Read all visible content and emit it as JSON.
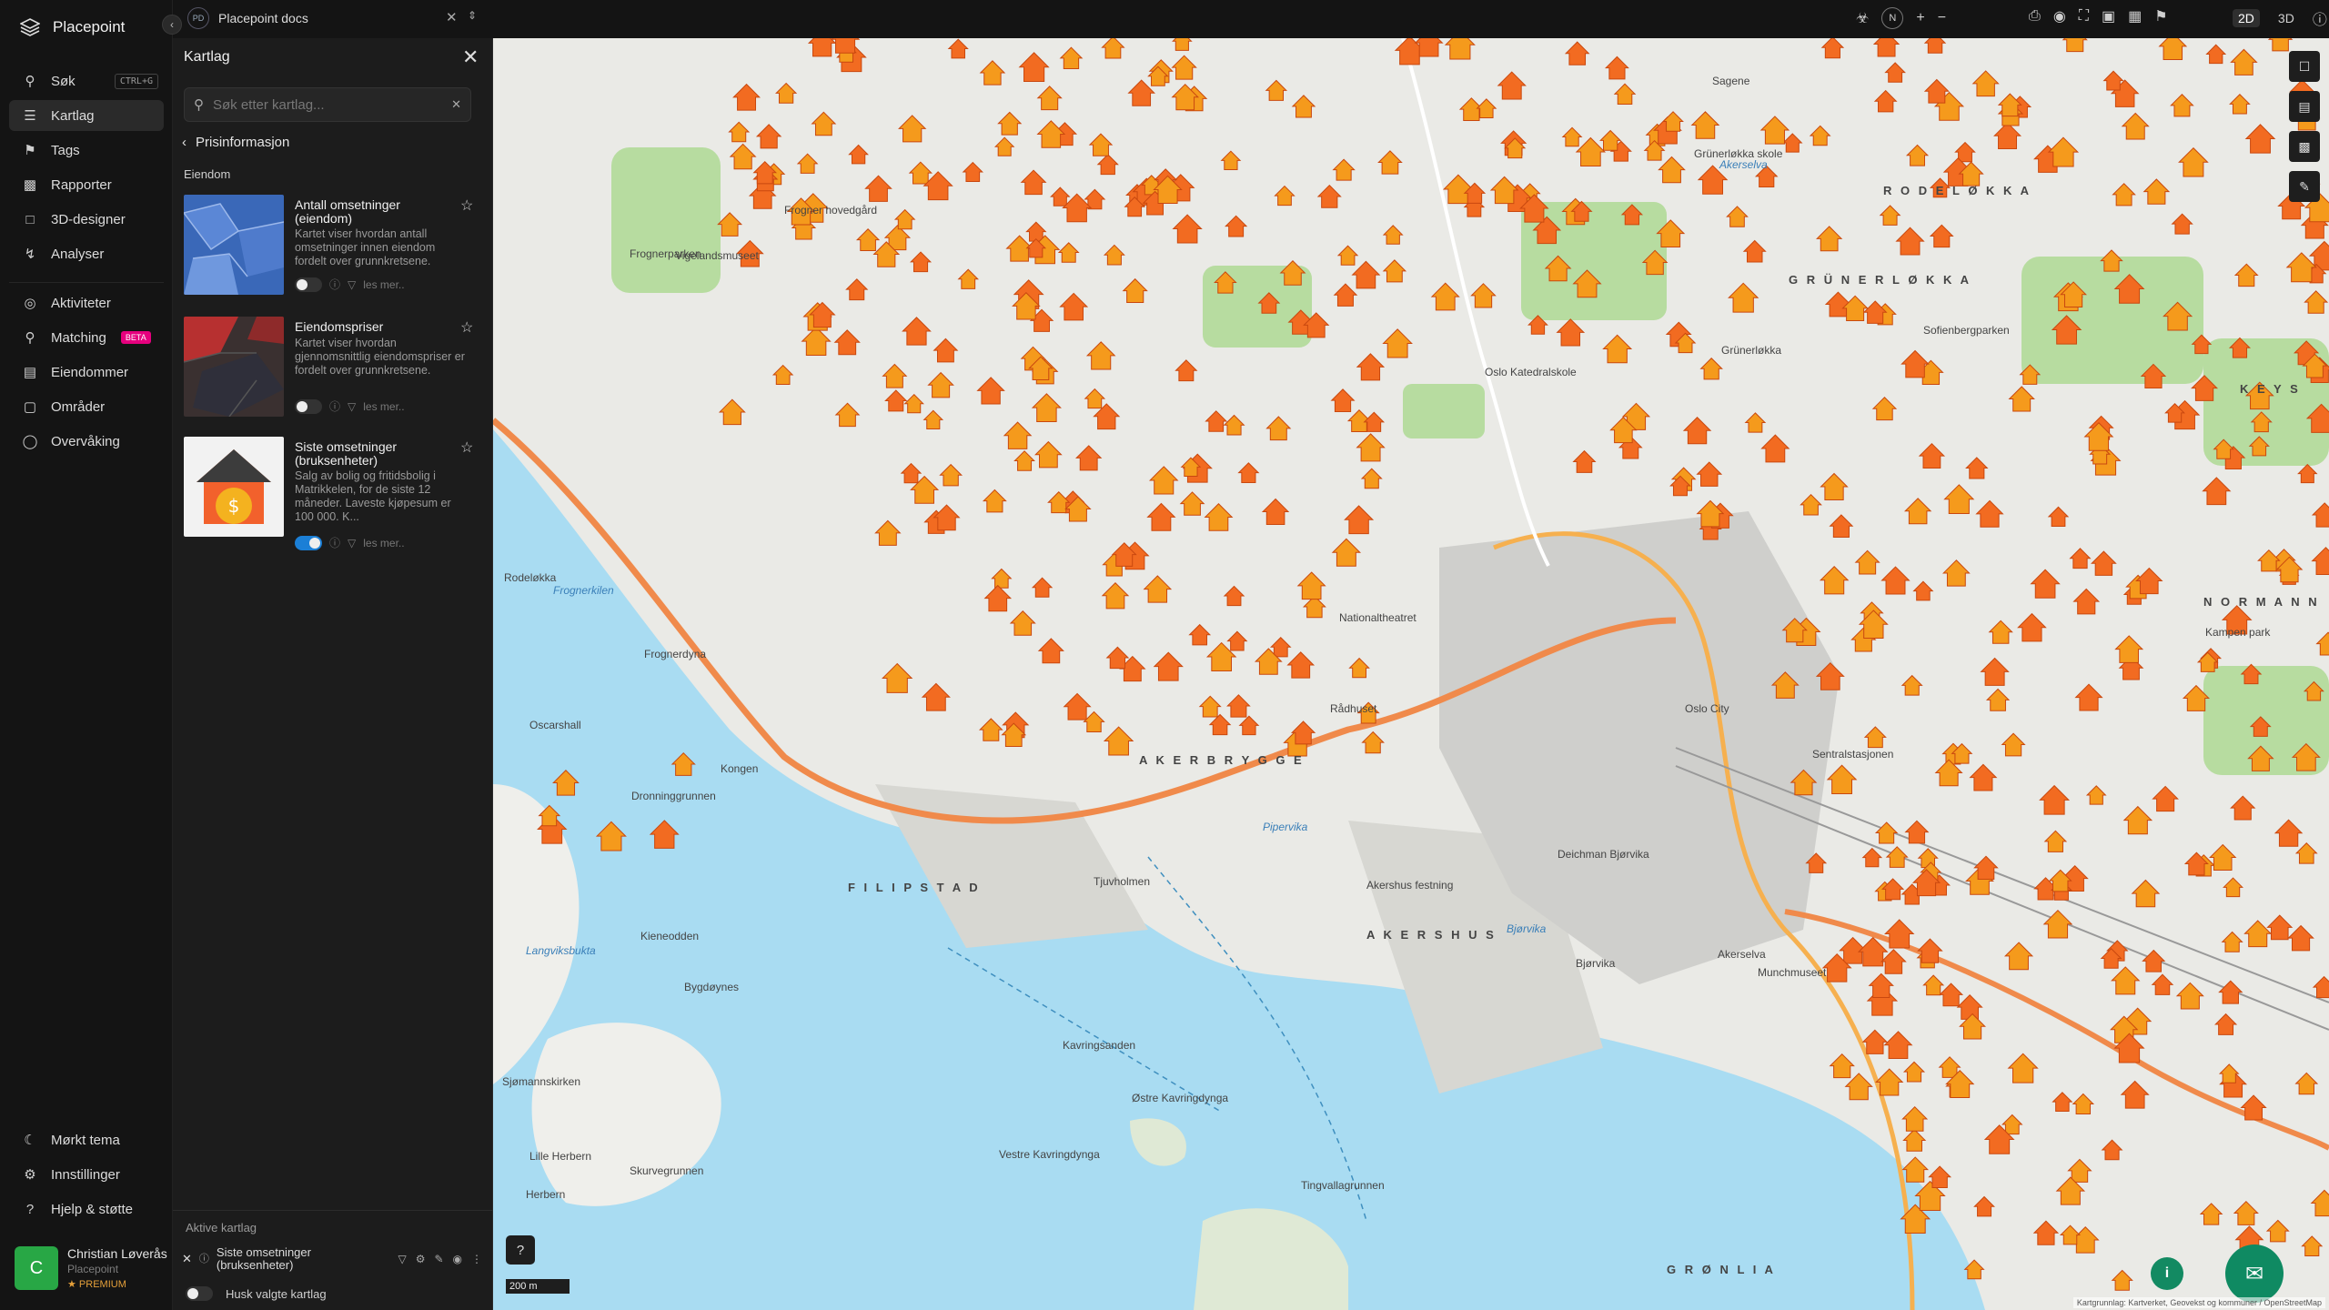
{
  "app": {
    "name": "Placepoint"
  },
  "topbar": {
    "doc_badge": "PD",
    "doc_title": "Placepoint docs",
    "modes": [
      "2D",
      "3D"
    ],
    "compass": "N"
  },
  "nav": {
    "items": [
      {
        "label": "Søk",
        "icon": "search-icon",
        "shortcut": "CTRL+G"
      },
      {
        "label": "Kartlag",
        "icon": "layers-icon"
      },
      {
        "label": "Tags",
        "icon": "bookmark-icon"
      },
      {
        "label": "Rapporter",
        "icon": "chart-icon"
      },
      {
        "label": "3D-designer",
        "icon": "cube-icon"
      },
      {
        "label": "Analyser",
        "icon": "lightning-icon"
      }
    ],
    "items2": [
      {
        "label": "Aktiviteter",
        "icon": "activity-icon"
      },
      {
        "label": "Matching",
        "icon": "match-icon",
        "badge": "BETA"
      },
      {
        "label": "Eiendommer",
        "icon": "document-icon"
      },
      {
        "label": "Områder",
        "icon": "area-icon"
      },
      {
        "label": "Overvåking",
        "icon": "monitor-icon"
      }
    ],
    "bottom": [
      {
        "label": "Mørkt tema",
        "icon": "moon-icon"
      },
      {
        "label": "Innstillinger",
        "icon": "gear-icon"
      },
      {
        "label": "Hjelp & støtte",
        "icon": "help-icon"
      }
    ],
    "user": {
      "initial": "C",
      "name": "Christian Løverås",
      "org": "Placepoint",
      "tier": "PREMIUM"
    }
  },
  "panel": {
    "title": "Kartlag",
    "search_placeholder": "Søk etter kartlag...",
    "breadcrumb": "Prisinformasjon",
    "section": "Eiendom",
    "read_more": "les mer..",
    "layers": [
      {
        "name": "Antall omsetninger (eiendom)",
        "desc": "Kartet viser hvordan antall omsetninger innen eiendom fordelt over grunnkretsene.",
        "enabled": false
      },
      {
        "name": "Eiendomspriser",
        "desc": "Kartet viser hvordan gjennomsnittlig eiendomspriser er fordelt over grunnkretsene.",
        "enabled": false
      },
      {
        "name": "Siste omsetninger (bruksenheter)",
        "desc": "Salg av bolig og fritidsbolig i Matrikkelen, for de siste 12 måneder. Laveste kjøpesum er 100 000. K...",
        "enabled": true
      }
    ],
    "active_heading": "Aktive kartlag",
    "active_layer": "Siste omsetninger (bruksenheter)",
    "remember_label": "Husk valgte kartlag"
  },
  "map": {
    "scale": "200 m",
    "attribution": "Kartgrunnlag: Kartverket, Geovekst og kommuner / OpenStreetMap",
    "labels_district": [
      "R O D E L Ø K K A",
      "G R Ü N E R L Ø K K A",
      "A K E R  B R Y G G E",
      "F I L I P S T A D",
      "A K E R S H U S",
      "G R Ø N L I A",
      "N O R M A N N",
      "K E Y S"
    ],
    "labels_place": [
      "Frognerparken",
      "Vigelandsmuseet",
      "Frogner hovedgård",
      "Oslo Katedralskole",
      "Grünerløkka",
      "Nationaltheatret",
      "Oslo City",
      "Sentralstasjonen",
      "Rådhuset",
      "Akershus festning",
      "Tjuvholmen",
      "Kongen",
      "Dronninggrunnen",
      "Bygdøynes",
      "Kieneodden",
      "Kavringsanden",
      "Østre Kavringdynga",
      "Vestre Kavringdynga",
      "Tingvallagrunnen",
      "Herbern",
      "Skurvegrunnen",
      "Lille Herbern",
      "Sjømannskirken",
      "Frognerdyna",
      "Oscarshall",
      "Rodeløkka",
      "Kampen park",
      "Sofienbergparken",
      "Grünerløkka skole",
      "Sagene",
      "Bjørvika",
      "Akerselva",
      "Munchmuseet",
      "Deichman Bjørvika"
    ],
    "labels_water": [
      "Frognerkilen",
      "Langviksbukta",
      "Pipervika",
      "Bjørvika",
      "Akerselva"
    ]
  }
}
